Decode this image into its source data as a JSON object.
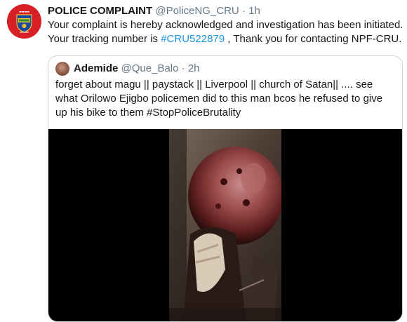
{
  "tweet": {
    "author_name": "POLICE COMPLAINT",
    "handle": "@PoliceNG_CRU",
    "separator": "·",
    "time": "1h",
    "text_before": "Your complaint is hereby acknowledged and investigation has been initiated. Your tracking number is ",
    "hashtag": "#CRU522879",
    "text_after": " , Thank you for contacting NPF-CRU.",
    "avatar_icon": "police-crest-icon"
  },
  "quoted": {
    "author_name": "Ademide",
    "handle": "@Que_Balo",
    "separator": "·",
    "time": "2h",
    "text": "forget about magu || paystack || Liverpool || church of Satan|| .... see what Orilowo Ejigbo policemen did to this man bcos he refused to give up his bike to them  #StopPoliceBrutality",
    "media_type": "video-thumbnail"
  },
  "colors": {
    "link": "#1b95e0",
    "muted": "#657786",
    "border": "#ccd6dd",
    "brand_red": "#d71f26"
  }
}
